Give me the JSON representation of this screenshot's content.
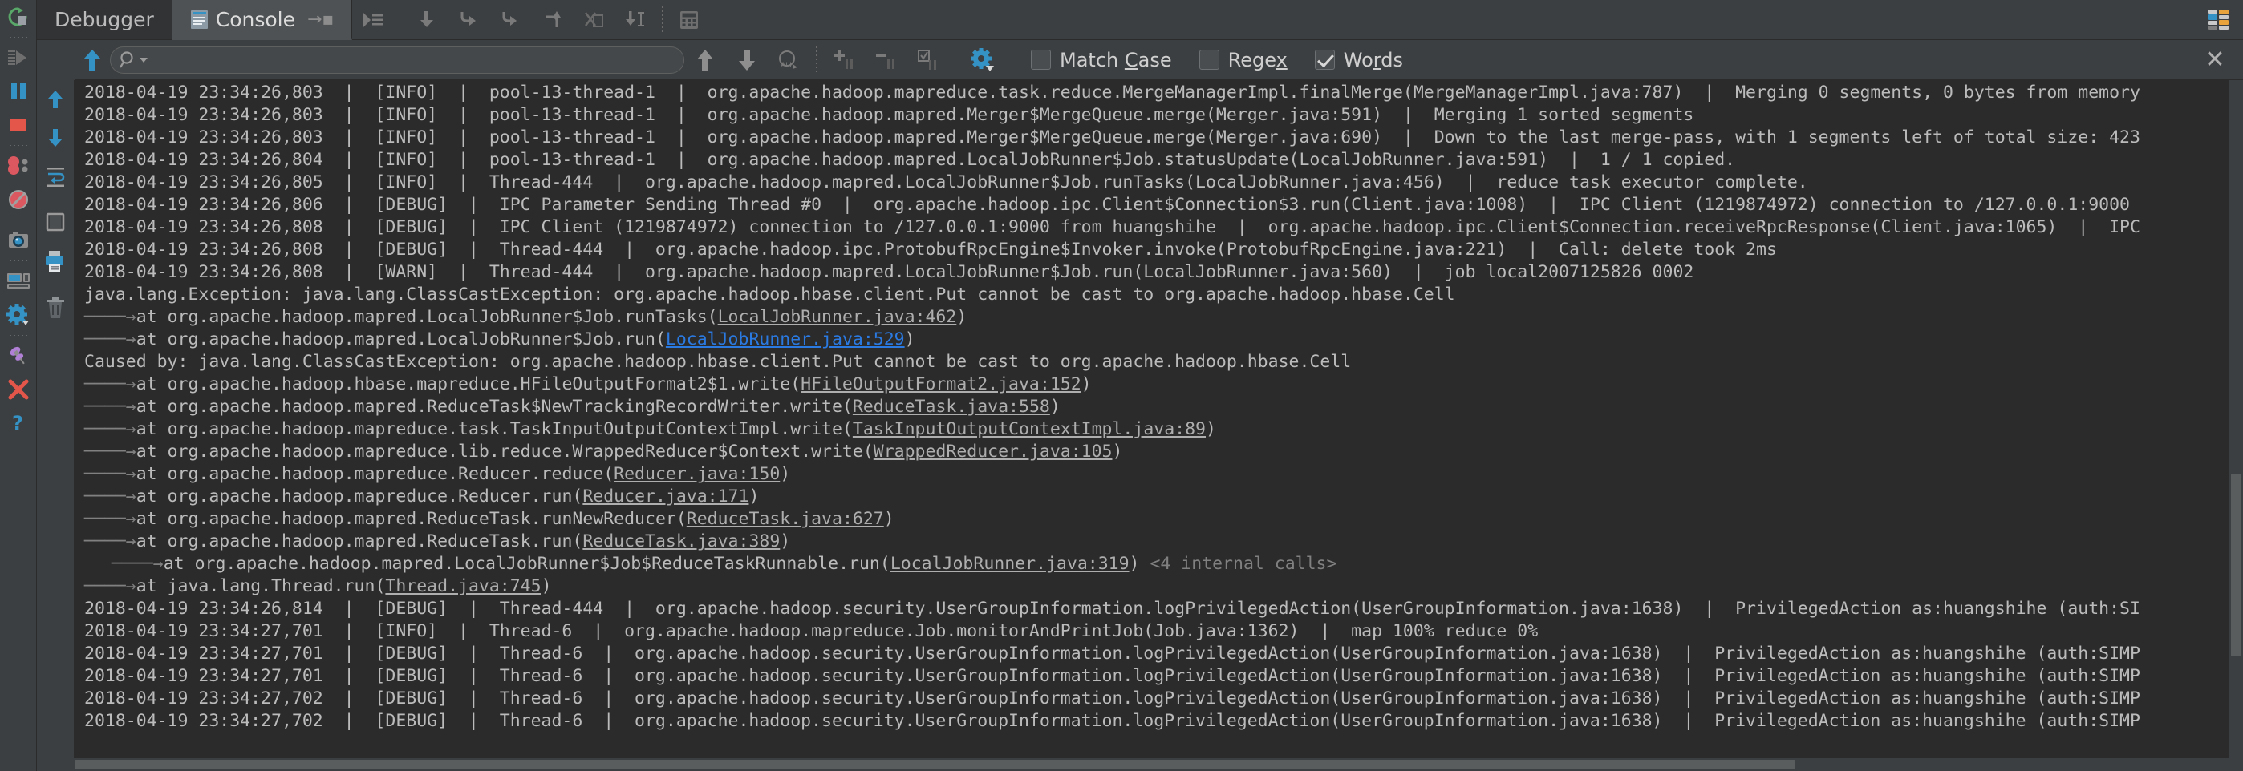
{
  "window": {
    "title": "Debugger Console"
  },
  "run_toolbar": {
    "items": [
      {
        "name": "rerun-icon",
        "label": "Rerun"
      },
      {
        "name": "resume-program-icon",
        "label": "Resume Program"
      },
      {
        "name": "pause-program-icon",
        "label": "Pause Program"
      },
      {
        "name": "stop-icon",
        "label": "Stop"
      },
      {
        "name": "view-breakpoints-icon",
        "label": "View Breakpoints"
      },
      {
        "name": "mute-breakpoints-icon",
        "label": "Mute Breakpoints"
      },
      {
        "name": "get-thread-dump-icon",
        "label": "Get Thread Dump"
      },
      {
        "name": "settings-layout-icon",
        "label": "Layout Settings"
      },
      {
        "name": "gear-icon",
        "label": "Settings"
      },
      {
        "name": "pin-tab-icon",
        "label": "Pin Tab"
      },
      {
        "name": "close-icon",
        "label": "Close"
      },
      {
        "name": "help-icon",
        "label": "Help"
      }
    ]
  },
  "tabs": [
    {
      "label": "Debugger",
      "active": false,
      "icon": "debugger-icon",
      "pinned": false
    },
    {
      "label": "Console",
      "active": true,
      "icon": "console-icon",
      "pinned": true
    }
  ],
  "tab_toolbar": {
    "items": [
      {
        "name": "show-execution-point-icon",
        "label": "Show Execution Point"
      },
      {
        "name": "step-over-icon",
        "label": "Step Over"
      },
      {
        "name": "step-into-icon",
        "label": "Step Into"
      },
      {
        "name": "force-step-into-icon",
        "label": "Force Step Into"
      },
      {
        "name": "step-out-icon",
        "label": "Step Out"
      },
      {
        "name": "drop-frame-icon",
        "label": "Drop Frame"
      },
      {
        "name": "run-to-cursor-icon",
        "label": "Run to Cursor"
      },
      {
        "name": "evaluate-expression-icon",
        "label": "Evaluate Expression"
      }
    ],
    "thread_icon": "threads-icon"
  },
  "search": {
    "value": "",
    "placeholder": "",
    "magnifier_icon": "search-icon",
    "dropdown_icon": "chevron-down-icon",
    "buttons": [
      {
        "name": "find-previous-icon",
        "label": "Find Previous"
      },
      {
        "name": "find-next-icon",
        "label": "Find Next"
      },
      {
        "name": "select-all-icon",
        "label": "Select All Occurrences"
      },
      {
        "name": "add-line-icon",
        "label": "Add Line"
      },
      {
        "name": "remove-line-icon",
        "label": "Remove Line"
      },
      {
        "name": "toggle-line-icon",
        "label": "Toggle Line"
      },
      {
        "name": "filter-gear-icon",
        "label": "Filter Settings"
      }
    ],
    "options": [
      {
        "name": "match-case-checkbox",
        "label_pre": "Match ",
        "label_mnemonic": "C",
        "label_post": "ase",
        "checked": false
      },
      {
        "name": "regex-checkbox",
        "label_pre": "Rege",
        "label_mnemonic": "x",
        "label_post": "",
        "checked": false
      },
      {
        "name": "words-checkbox",
        "label_pre": "Wo",
        "label_mnemonic": "r",
        "label_post": "ds",
        "checked": true
      }
    ],
    "close_label": "✕"
  },
  "console_gutter": {
    "items": [
      {
        "name": "scroll-up-icon",
        "label": "Up the Stack Trace"
      },
      {
        "name": "scroll-down-icon",
        "label": "Down the Stack Trace"
      },
      {
        "name": "soft-wrap-icon",
        "label": "Use Soft Wraps"
      },
      {
        "name": "scroll-to-end-icon",
        "label": "Scroll to the End"
      },
      {
        "name": "print-icon",
        "label": "Print"
      },
      {
        "name": "clear-all-icon",
        "label": "Clear All"
      }
    ]
  },
  "console": {
    "lines": [
      {
        "type": "log",
        "text": "2018-04-19 23:34:26,803  |  [INFO]  |  pool-13-thread-1  |  org.apache.hadoop.mapreduce.task.reduce.MergeManagerImpl.finalMerge(MergeManagerImpl.java:787)  |  Merging 0 segments, 0 bytes from memory"
      },
      {
        "type": "log",
        "text": "2018-04-19 23:34:26,803  |  [INFO]  |  pool-13-thread-1  |  org.apache.hadoop.mapred.Merger$MergeQueue.merge(Merger.java:591)  |  Merging 1 sorted segments"
      },
      {
        "type": "log",
        "text": "2018-04-19 23:34:26,803  |  [INFO]  |  pool-13-thread-1  |  org.apache.hadoop.mapred.Merger$MergeQueue.merge(Merger.java:690)  |  Down to the last merge-pass, with 1 segments left of total size: 423"
      },
      {
        "type": "log",
        "text": "2018-04-19 23:34:26,804  |  [INFO]  |  pool-13-thread-1  |  org.apache.hadoop.mapred.LocalJobRunner$Job.statusUpdate(LocalJobRunner.java:591)  |  1 / 1 copied."
      },
      {
        "type": "log",
        "text": "2018-04-19 23:34:26,805  |  [INFO]  |  Thread-444  |  org.apache.hadoop.mapred.LocalJobRunner$Job.runTasks(LocalJobRunner.java:456)  |  reduce task executor complete."
      },
      {
        "type": "log",
        "text": "2018-04-19 23:34:26,806  |  [DEBUG]  |  IPC Parameter Sending Thread #0  |  org.apache.hadoop.ipc.Client$Connection$3.run(Client.java:1008)  |  IPC Client (1219874972) connection to /127.0.0.1:9000"
      },
      {
        "type": "log",
        "text": "2018-04-19 23:34:26,808  |  [DEBUG]  |  IPC Client (1219874972) connection to /127.0.0.1:9000 from huangshihe  |  org.apache.hadoop.ipc.Client$Connection.receiveRpcResponse(Client.java:1065)  |  IPC"
      },
      {
        "type": "log",
        "text": "2018-04-19 23:34:26,808  |  [DEBUG]  |  Thread-444  |  org.apache.hadoop.ipc.ProtobufRpcEngine$Invoker.invoke(ProtobufRpcEngine.java:221)  |  Call: delete took 2ms"
      },
      {
        "type": "log",
        "text": "2018-04-19 23:34:26,808  |  [WARN]  |  Thread-444  |  org.apache.hadoop.mapred.LocalJobRunner$Job.run(LocalJobRunner.java:560)  |  job_local2007125826_0002"
      },
      {
        "type": "exc",
        "text": "java.lang.Exception: java.lang.ClassCastException: org.apache.hadoop.hbase.client.Put cannot be cast to org.apache.hadoop.hbase.Cell"
      },
      {
        "type": "trace",
        "indent": "────",
        "pre": "at org.apache.hadoop.mapred.LocalJobRunner$Job.runTasks(",
        "link": "LocalJobRunner.java:462",
        "link_style": "gray",
        "post": ")"
      },
      {
        "type": "trace",
        "indent": "────",
        "pre": "at org.apache.hadoop.mapred.LocalJobRunner$Job.run(",
        "link": "LocalJobRunner.java:529",
        "link_style": "blue",
        "post": ")"
      },
      {
        "type": "exc",
        "text": "Caused by: java.lang.ClassCastException: org.apache.hadoop.hbase.client.Put cannot be cast to org.apache.hadoop.hbase.Cell"
      },
      {
        "type": "trace",
        "indent": "────",
        "pre": "at org.apache.hadoop.hbase.mapreduce.HFileOutputFormat2$1.write(",
        "link": "HFileOutputFormat2.java:152",
        "link_style": "gray",
        "post": ")"
      },
      {
        "type": "trace",
        "indent": "────",
        "pre": "at org.apache.hadoop.mapred.ReduceTask$NewTrackingRecordWriter.write(",
        "link": "ReduceTask.java:558",
        "link_style": "gray",
        "post": ")"
      },
      {
        "type": "trace",
        "indent": "────",
        "pre": "at org.apache.hadoop.mapreduce.task.TaskInputOutputContextImpl.write(",
        "link": "TaskInputOutputContextImpl.java:89",
        "link_style": "gray",
        "post": ")"
      },
      {
        "type": "trace",
        "indent": "────",
        "pre": "at org.apache.hadoop.mapreduce.lib.reduce.WrappedReducer$Context.write(",
        "link": "WrappedReducer.java:105",
        "link_style": "gray",
        "post": ")"
      },
      {
        "type": "trace",
        "indent": "────",
        "pre": "at org.apache.hadoop.mapreduce.Reducer.reduce(",
        "link": "Reducer.java:150",
        "link_style": "gray",
        "post": ")"
      },
      {
        "type": "trace",
        "indent": "────",
        "pre": "at org.apache.hadoop.mapreduce.Reducer.run(",
        "link": "Reducer.java:171",
        "link_style": "gray",
        "post": ")"
      },
      {
        "type": "trace",
        "indent": "────",
        "pre": "at org.apache.hadoop.mapred.ReduceTask.runNewReducer(",
        "link": "ReduceTask.java:627",
        "link_style": "gray",
        "post": ")"
      },
      {
        "type": "trace",
        "indent": "────",
        "pre": "at org.apache.hadoop.mapred.ReduceTask.run(",
        "link": "ReduceTask.java:389",
        "link_style": "gray",
        "post": ")"
      },
      {
        "type": "trace",
        "indent": "────",
        "pre": "at org.apache.hadoop.mapred.LocalJobRunner$Job$ReduceTaskRunnable.run(",
        "link": "LocalJobRunner.java:319",
        "link_style": "gray",
        "post": ")",
        "folded": "<4 internal calls>",
        "fold_marker": "+"
      },
      {
        "type": "trace",
        "indent": "────",
        "pre": "at java.lang.Thread.run(",
        "link": "Thread.java:745",
        "link_style": "gray",
        "post": ")"
      },
      {
        "type": "log",
        "text": "2018-04-19 23:34:26,814  |  [DEBUG]  |  Thread-444  |  org.apache.hadoop.security.UserGroupInformation.logPrivilegedAction(UserGroupInformation.java:1638)  |  PrivilegedAction as:huangshihe (auth:SI"
      },
      {
        "type": "log",
        "text": "2018-04-19 23:34:27,701  |  [INFO]  |  Thread-6  |  org.apache.hadoop.mapreduce.Job.monitorAndPrintJob(Job.java:1362)  |  map 100% reduce 0%"
      },
      {
        "type": "log",
        "text": "2018-04-19 23:34:27,701  |  [DEBUG]  |  Thread-6  |  org.apache.hadoop.security.UserGroupInformation.logPrivilegedAction(UserGroupInformation.java:1638)  |  PrivilegedAction as:huangshihe (auth:SIMP"
      },
      {
        "type": "log",
        "text": "2018-04-19 23:34:27,701  |  [DEBUG]  |  Thread-6  |  org.apache.hadoop.security.UserGroupInformation.logPrivilegedAction(UserGroupInformation.java:1638)  |  PrivilegedAction as:huangshihe (auth:SIMP"
      },
      {
        "type": "log",
        "text": "2018-04-19 23:34:27,702  |  [DEBUG]  |  Thread-6  |  org.apache.hadoop.security.UserGroupInformation.logPrivilegedAction(UserGroupInformation.java:1638)  |  PrivilegedAction as:huangshihe (auth:SIMP"
      },
      {
        "type": "log",
        "text": "2018-04-19 23:34:27,702  |  [DEBUG]  |  Thread-6  |  org.apache.hadoop.security.UserGroupInformation.logPrivilegedAction(UserGroupInformation.java:1638)  |  PrivilegedAction as:huangshihe (auth:SIMP"
      }
    ]
  },
  "colors": {
    "background": "#3c3f41",
    "console_bg": "#2b2b2b",
    "text": "#bbbbbb",
    "accent_blue": "#3592c4",
    "link_blue": "#2a7ae2",
    "link_gray": "#aeaeae",
    "stop_red": "#e4554a",
    "tab_active": "#4e5254"
  }
}
